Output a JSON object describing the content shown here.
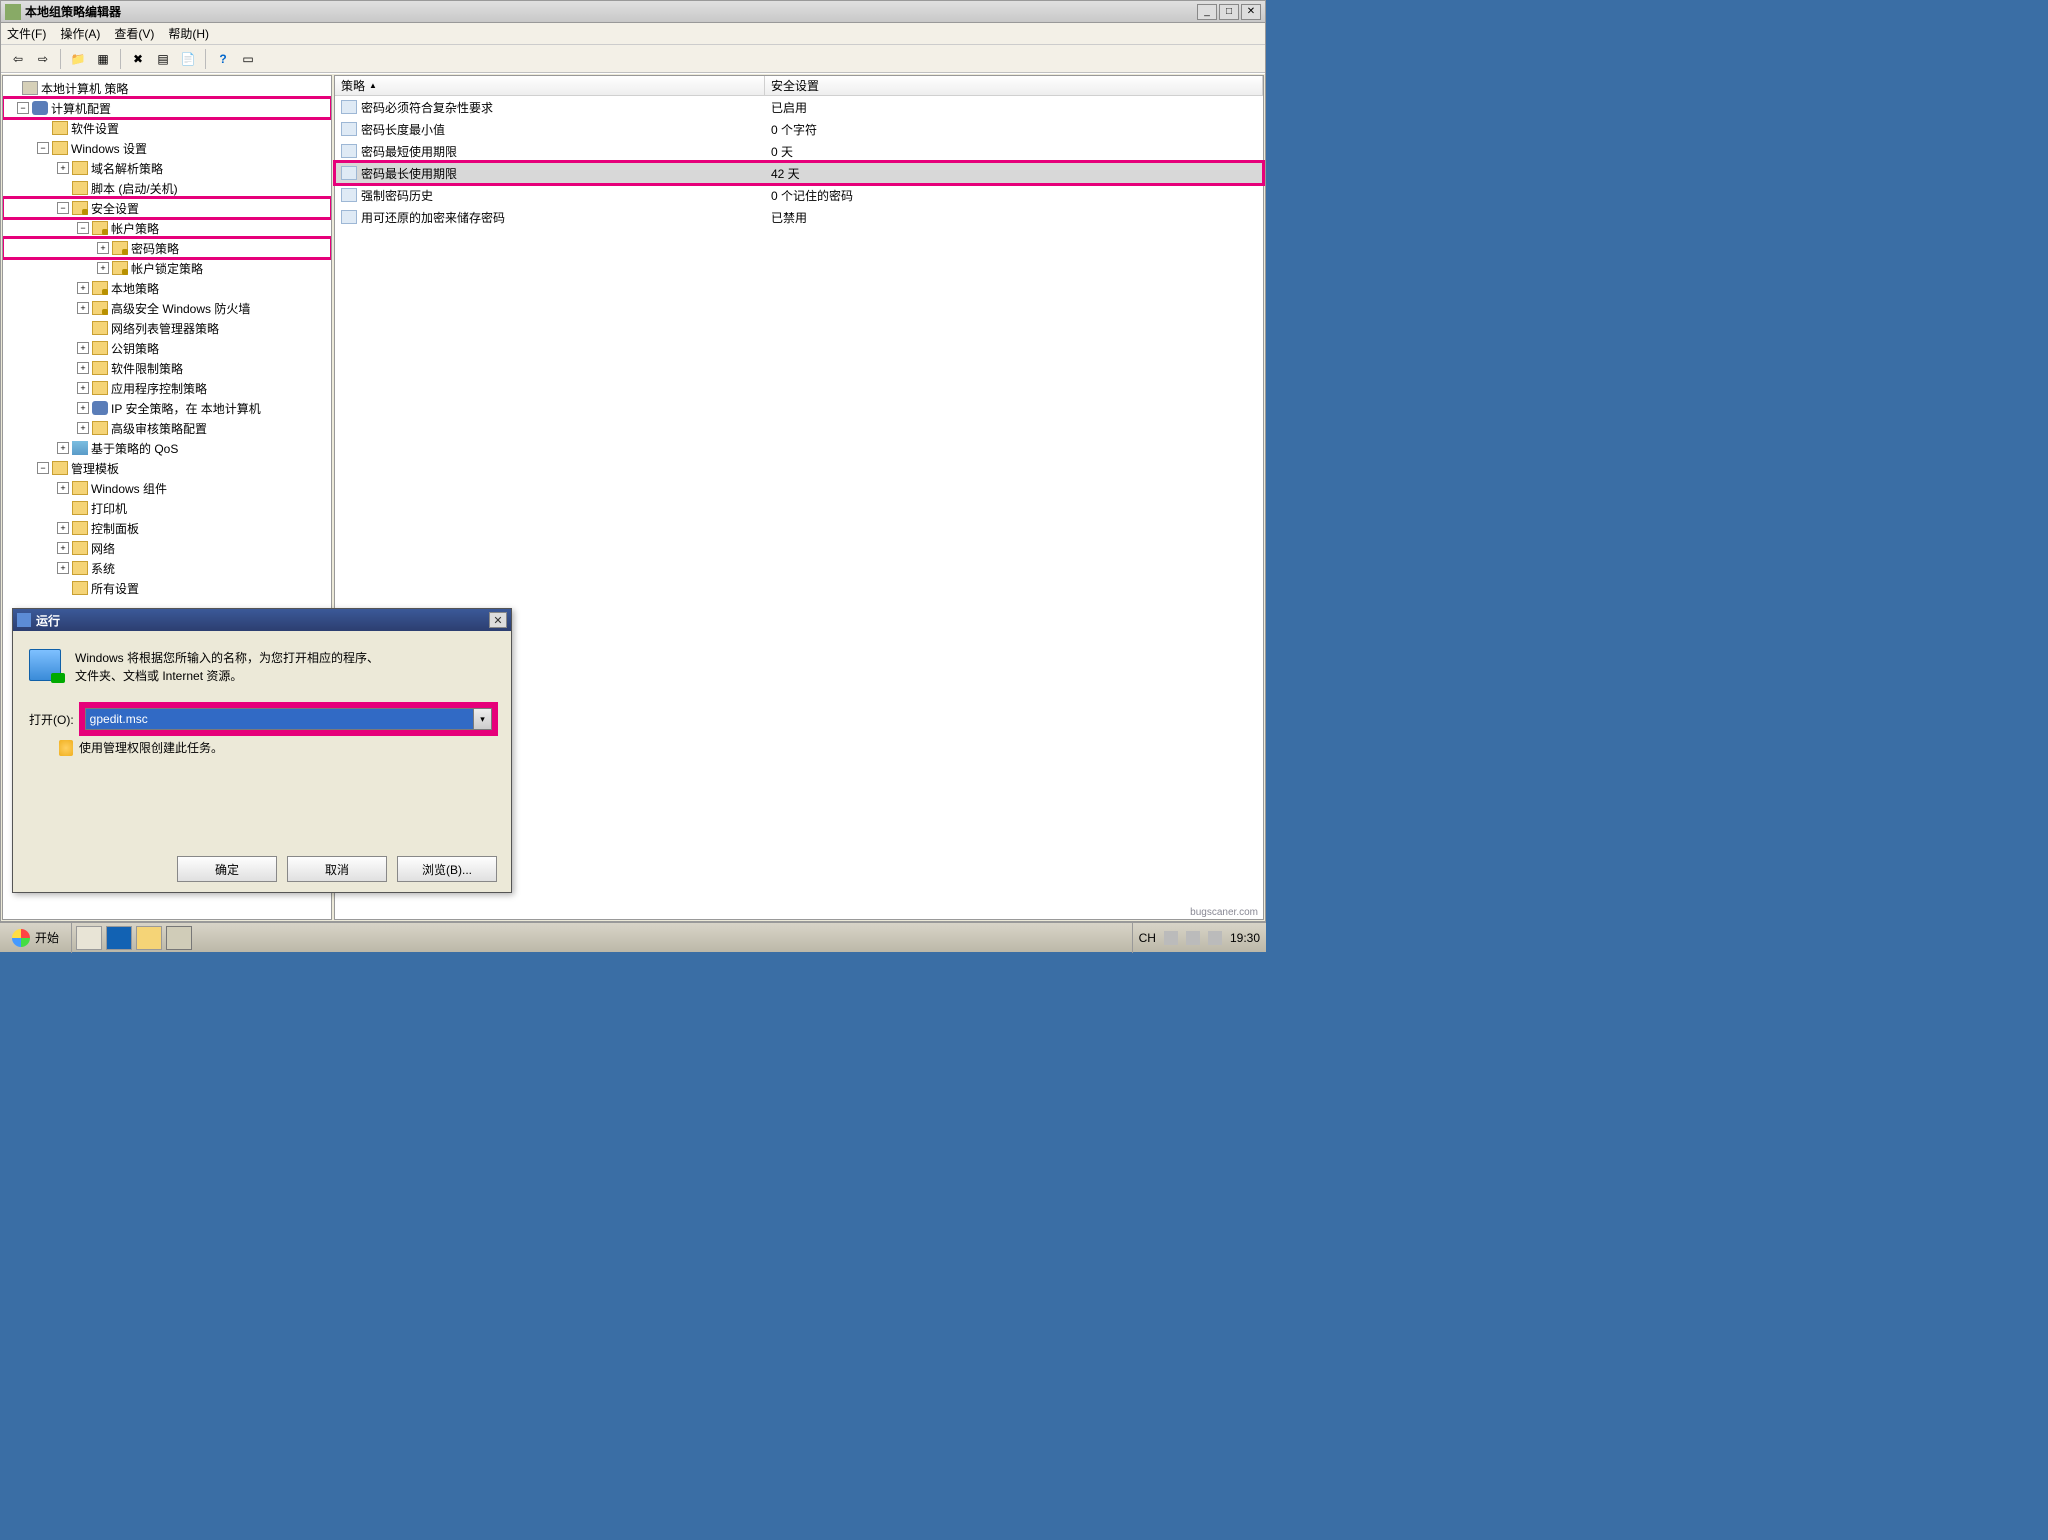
{
  "window": {
    "title": "本地组策略编辑器"
  },
  "menu": {
    "file": "文件(F)",
    "action": "操作(A)",
    "view": "查看(V)",
    "help": "帮助(H)"
  },
  "tree": {
    "root": "本地计算机 策略",
    "computer": "计算机配置",
    "software": "软件设置",
    "windows_settings": "Windows 设置",
    "dns": "域名解析策略",
    "scripts": "脚本 (启动/关机)",
    "security": "安全设置",
    "account_policies": "帐户策略",
    "password_policy": "密码策略",
    "lockout": "帐户锁定策略",
    "local_pol": "本地策略",
    "firewall": "高级安全 Windows 防火墙",
    "netlist": "网络列表管理器策略",
    "pubkey": "公钥策略",
    "swrestrict": "软件限制策略",
    "appctrl": "应用程序控制策略",
    "ipsec": "IP 安全策略，在 本地计算机",
    "audit": "高级审核策略配置",
    "qos": "基于策略的 QoS",
    "admin_tpl": "管理模板",
    "win_comp": "Windows 组件",
    "printers": "打印机",
    "ctrlpanel": "控制面板",
    "network": "网络",
    "system": "系统",
    "all_settings": "所有设置"
  },
  "list": {
    "col_policy": "策略",
    "col_security": "安全设置",
    "rows": [
      {
        "policy": "密码必须符合复杂性要求",
        "value": "已启用"
      },
      {
        "policy": "密码长度最小值",
        "value": "0 个字符"
      },
      {
        "policy": "密码最短使用期限",
        "value": "0 天"
      },
      {
        "policy": "密码最长使用期限",
        "value": "42 天"
      },
      {
        "policy": "强制密码历史",
        "value": "0 个记住的密码"
      },
      {
        "policy": "用可还原的加密来储存密码",
        "value": "已禁用"
      }
    ]
  },
  "run": {
    "title": "运行",
    "desc1": "Windows 将根据您所输入的名称，为您打开相应的程序、",
    "desc2": "文件夹、文档或 Internet 资源。",
    "open_label": "打开(O):",
    "value": "gpedit.msc",
    "admin_note": "使用管理权限创建此任务。",
    "ok": "确定",
    "cancel": "取消",
    "browse": "浏览(B)..."
  },
  "taskbar": {
    "start": "开始",
    "lang": "CH",
    "time": "19:30"
  },
  "watermark": "bugscaner.com"
}
